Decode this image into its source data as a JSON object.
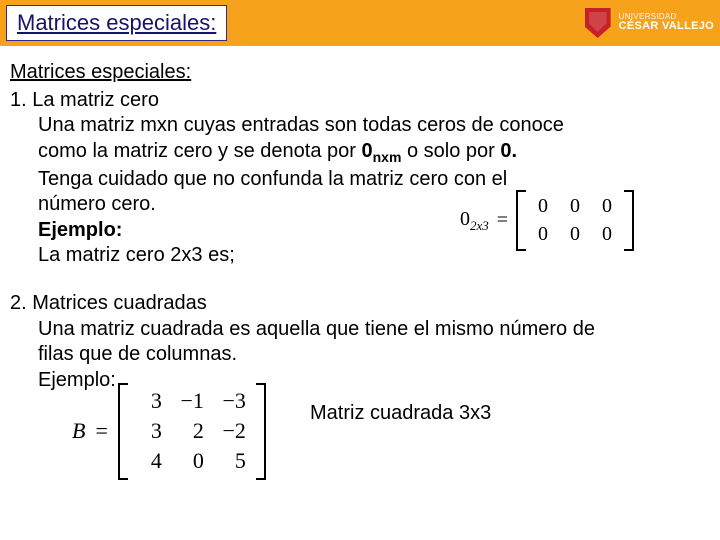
{
  "header": {
    "title": "Matrices especiales:",
    "university": {
      "line1": "UNIVERSIDAD",
      "line2": "CÉSAR VALLEJO"
    }
  },
  "section1": {
    "subtitle": "Matrices especiales:",
    "item_no": "1.",
    "item_title": "La matriz cero",
    "para_a": "Una matriz mxn cuyas entradas son todas ceros de conoce",
    "para_b_pre": "como la matriz cero y se denota por ",
    "zero_nm": "0",
    "zero_nm_sub": "nxm",
    "para_b_mid": " o solo por ",
    "zero_bold": "0.",
    "para_c": "Tenga cuidado que no confunda la matriz cero con el",
    "para_d": "número cero.",
    "ejemplo": "Ejemplo:",
    "para_e": "La matriz cero 2x3 es;",
    "eq_lhs": "0",
    "eq_lhs_sub": "2x3",
    "eq_eq": "=",
    "matrix_zero": [
      [
        "0",
        "0",
        "0"
      ],
      [
        "0",
        "0",
        "0"
      ]
    ]
  },
  "section2": {
    "item_no": "2.",
    "item_title": "Matrices cuadradas",
    "para_a": "Una matriz cuadrada es aquella que tiene el mismo número de",
    "para_b": "filas que de columnas.",
    "ejemplo": "Ejemplo:",
    "eq_lhs": "B",
    "eq_eq": "=",
    "matrix_B": [
      [
        "3",
        "−1",
        "−3"
      ],
      [
        "3",
        "2",
        "−2"
      ],
      [
        "4",
        "0",
        "5"
      ]
    ],
    "caption": "Matriz  cuadrada 3x3"
  }
}
